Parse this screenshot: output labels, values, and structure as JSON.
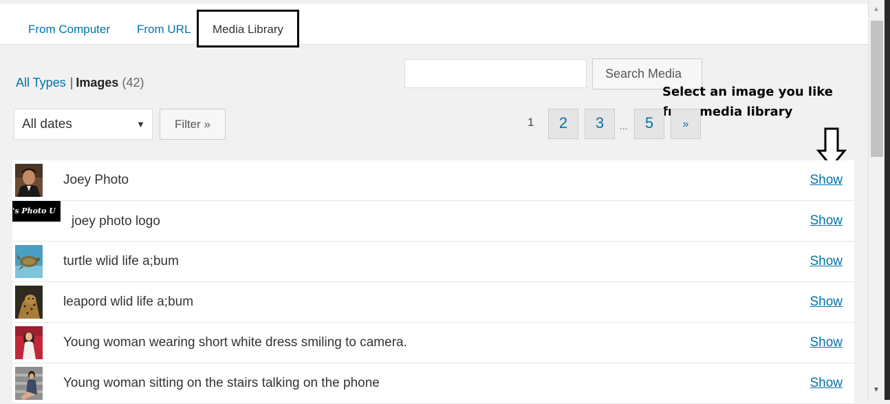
{
  "tabs": {
    "from_computer": "From Computer",
    "from_url": "From URL",
    "media_library": "Media Library"
  },
  "type_filter": {
    "all_types": "All Types",
    "separator": "|",
    "images_label": "Images",
    "images_count": "(42)"
  },
  "search": {
    "value": "",
    "button_label": "Search Media"
  },
  "annotation": {
    "line1": "Select an image  you like",
    "line2": "from media library",
    "arrow_icon": "down-arrow-icon"
  },
  "date_filter": {
    "selected": "All dates",
    "caret": "▼"
  },
  "filter_button": "Filter »",
  "pagination": {
    "current": "1",
    "page2": "2",
    "page3": "3",
    "ellipsis": "...",
    "last": "5",
    "next": "»"
  },
  "media_items": [
    {
      "title": "Joey Photo",
      "action": "Show",
      "thumb": "portrait-man-thumbnail"
    },
    {
      "title": "joey photo logo",
      "action": "Show",
      "thumb": "logo-thumbnail",
      "thumb_text": "'s Photo U"
    },
    {
      "title": "turtle wlid life a;bum",
      "action": "Show",
      "thumb": "turtle-thumbnail"
    },
    {
      "title": "leapord wlid life a;bum",
      "action": "Show",
      "thumb": "leopard-thumbnail"
    },
    {
      "title": "Young woman wearing short white dress smiling to camera.",
      "action": "Show",
      "thumb": "woman-white-dress-thumbnail"
    },
    {
      "title": "Young woman sitting on the stairs talking on the phone",
      "action": "Show",
      "thumb": "woman-stairs-thumbnail"
    }
  ],
  "colors": {
    "link": "#0073aa",
    "background": "#f1f1f1",
    "annotation_border": "#000000"
  }
}
